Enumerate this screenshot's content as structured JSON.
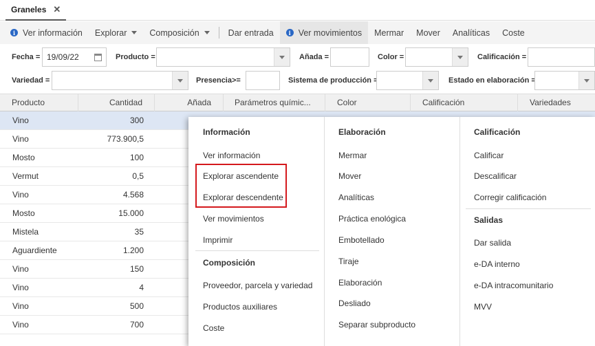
{
  "tab": {
    "label": "Graneles",
    "close": "✕"
  },
  "toolbar": {
    "ver_informacion": "Ver información",
    "explorar": "Explorar",
    "composicion": "Composición",
    "dar_entrada": "Dar entrada",
    "ver_movimientos": "Ver movimientos",
    "mermar": "Mermar",
    "mover": "Mover",
    "analiticas": "Analíticas",
    "coste": "Coste"
  },
  "filters": {
    "fecha_label": "Fecha =",
    "fecha_value": "19/09/22",
    "producto_label": "Producto =",
    "anada_label": "Añada =",
    "color_label": "Color =",
    "calificacion_label": "Calificación =",
    "variedad_label": "Variedad =",
    "presencia_label": "Presencia>=",
    "sistema_label": "Sistema de producción =",
    "estado_label": "Estado en elaboración ="
  },
  "columns": {
    "producto": "Producto",
    "cantidad": "Cantidad",
    "anada": "Añada",
    "parametros": "Parámetros químic...",
    "color": "Color",
    "calificacion": "Calificación",
    "variedades": "Variedades"
  },
  "rows": [
    {
      "producto": "Vino",
      "cantidad": "300"
    },
    {
      "producto": "Vino",
      "cantidad": "773.900,5"
    },
    {
      "producto": "Mosto",
      "cantidad": "100"
    },
    {
      "producto": "Vermut",
      "cantidad": "0,5"
    },
    {
      "producto": "Vino",
      "cantidad": "4.568"
    },
    {
      "producto": "Mosto",
      "cantidad": "15.000"
    },
    {
      "producto": "Mistela",
      "cantidad": "35"
    },
    {
      "producto": "Aguardiente",
      "cantidad": "1.200"
    },
    {
      "producto": "Vino",
      "cantidad": "150"
    },
    {
      "producto": "Vino",
      "cantidad": "4"
    },
    {
      "producto": "Vino",
      "cantidad": "500"
    },
    {
      "producto": "Vino",
      "cantidad": "700"
    }
  ],
  "menu": {
    "informacion": {
      "title": "Información",
      "items": [
        "Ver información",
        "Explorar ascendente",
        "Explorar descendente",
        "Ver movimientos",
        "Imprimir"
      ]
    },
    "composicion": {
      "title": "Composición",
      "items": [
        "Proveedor, parcela y variedad",
        "Productos auxiliares",
        "Coste"
      ]
    },
    "elaboracion": {
      "title": "Elaboración",
      "items": [
        "Mermar",
        "Mover",
        "Analíticas",
        "Práctica enológica",
        "Embotellado",
        "Tiraje",
        "Elaboración",
        "Desliado",
        "Separar subproducto"
      ]
    },
    "calificacion": {
      "title": "Calificación",
      "items": [
        "Calificar",
        "Descalificar",
        "Corregir calificación"
      ]
    },
    "salidas": {
      "title": "Salidas",
      "items": [
        "Dar salida",
        "e-DA interno",
        "e-DA intracomunitario",
        "MVV"
      ]
    }
  },
  "colors": {
    "accent": "#2a68c5",
    "highlight": "#d4181c",
    "selected_row": "#dde6f4"
  }
}
